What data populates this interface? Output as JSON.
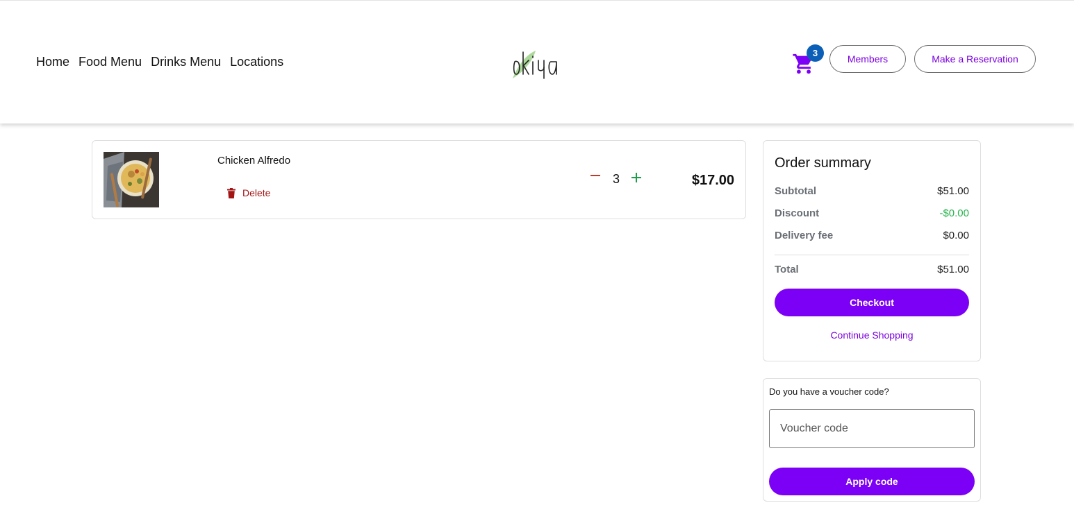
{
  "nav": {
    "items": [
      "Home",
      "Food Menu",
      "Drinks Menu",
      "Locations"
    ]
  },
  "logo": {
    "text": "okiya",
    "icon": "leaf-logo"
  },
  "header": {
    "cart_count": "3",
    "cart_icon": "cart-icon",
    "members_label": "Members",
    "reservation_label": "Make a Reservation"
  },
  "cart": {
    "items": [
      {
        "name": "Chicken Alfredo",
        "delete_label": "Delete",
        "quantity": "3",
        "price": "$17.00"
      }
    ]
  },
  "summary": {
    "title": "Order summary",
    "subtotal_label": "Subtotal",
    "subtotal_value": "$51.00",
    "discount_label": "Discount",
    "discount_value": "-$0.00",
    "delivery_label": "Delivery fee",
    "delivery_value": "$0.00",
    "total_label": "Total",
    "total_value": "$51.00",
    "checkout_label": "Checkout",
    "continue_label": "Continue Shopping"
  },
  "voucher": {
    "question": "Do you have a voucher code?",
    "placeholder": "Voucher code",
    "apply_label": "Apply code"
  },
  "colors": {
    "accent": "#7b00f5",
    "badge": "#0b5fb7",
    "delete": "#a31515",
    "plus": "#1e9e4a",
    "minus": "#c0392b",
    "discount": "#28b44e"
  }
}
